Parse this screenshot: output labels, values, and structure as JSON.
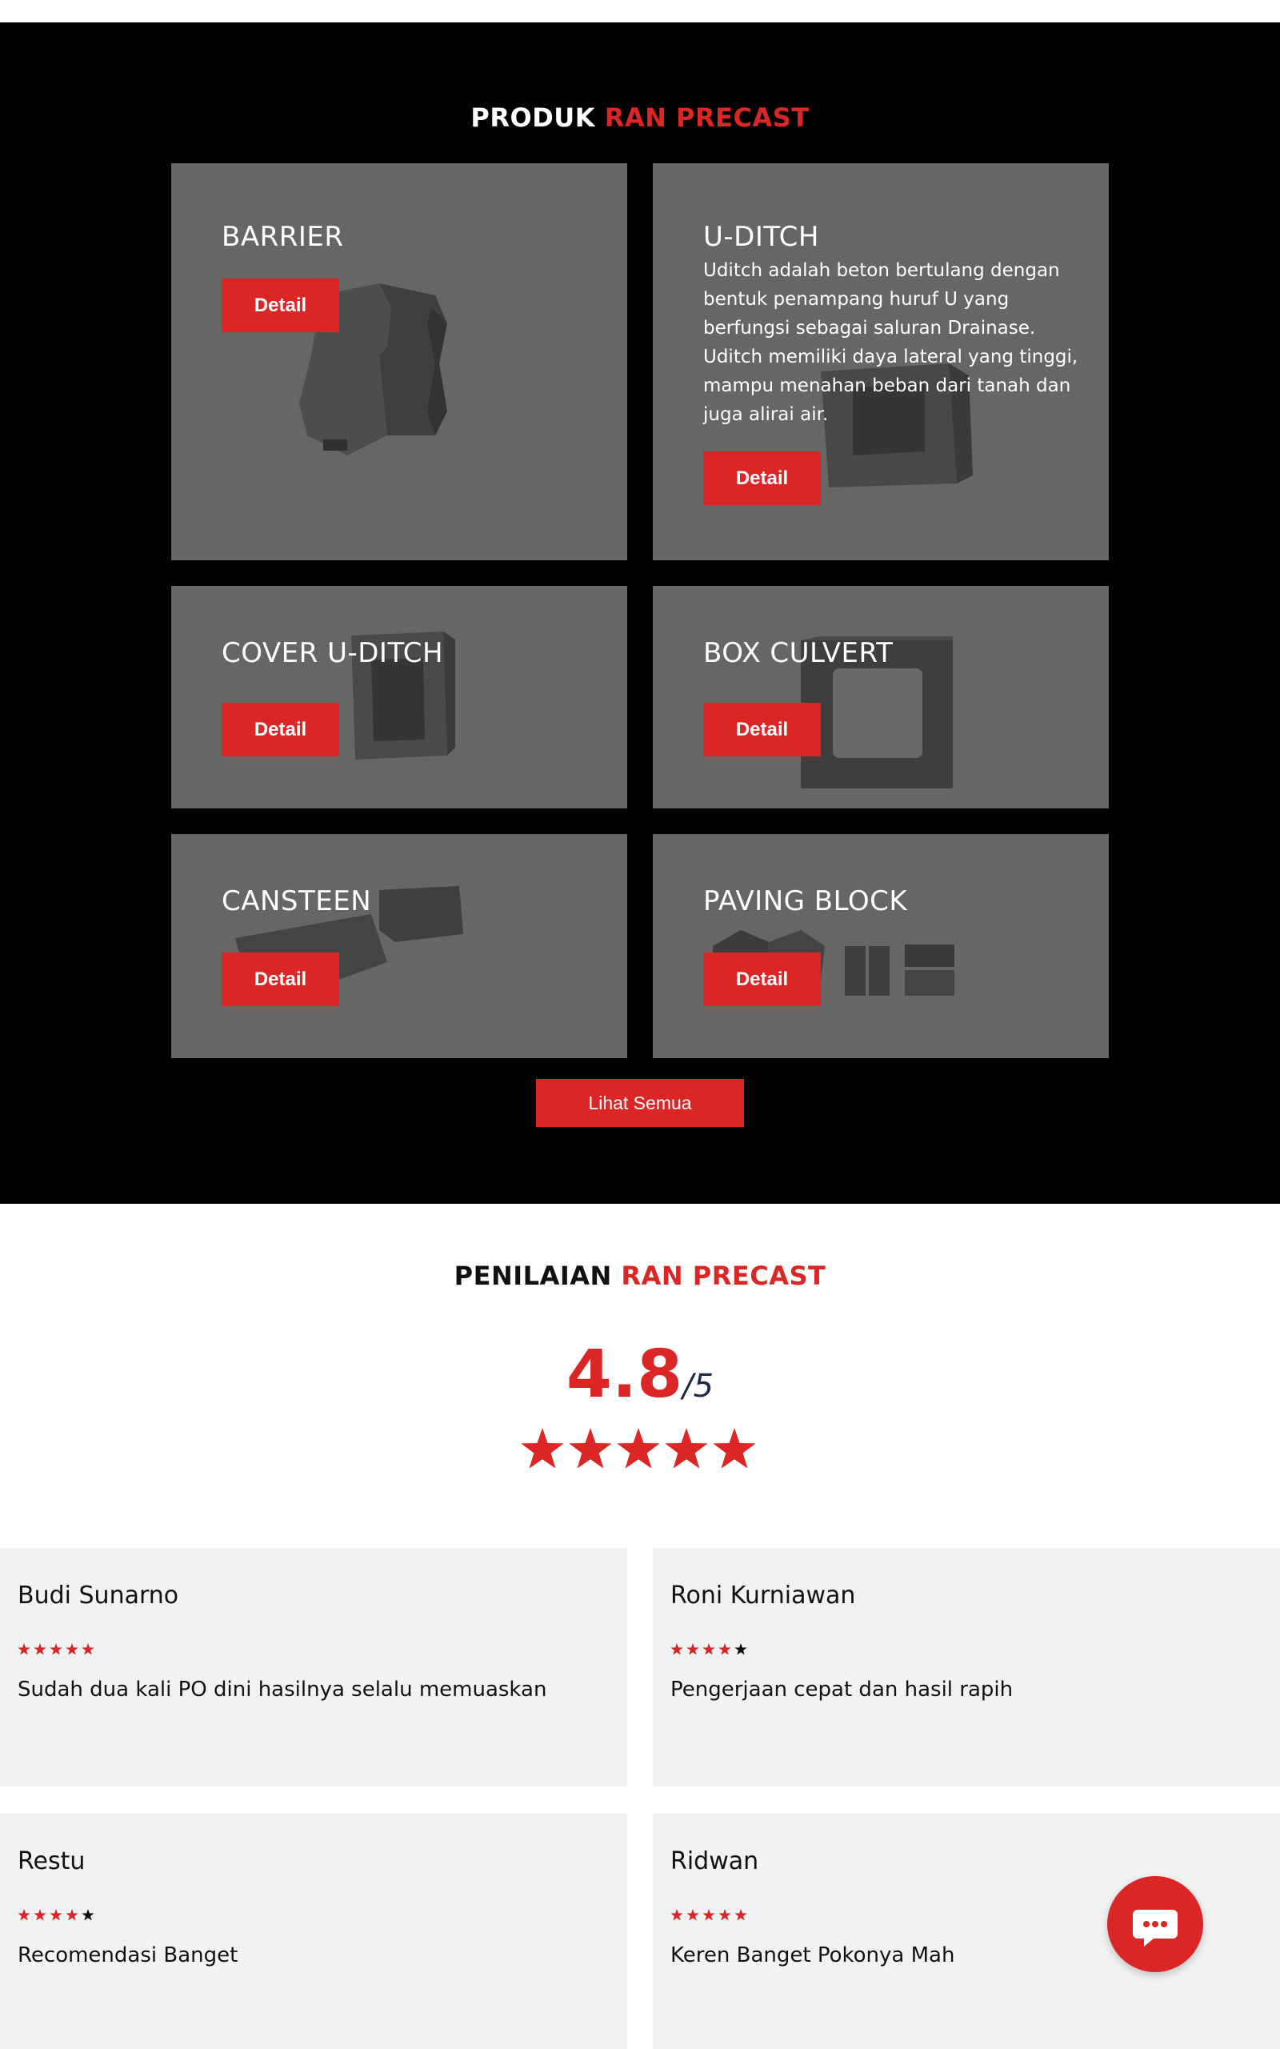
{
  "products": {
    "title_prefix": "PRODUK",
    "title_brand": "RAN PRECAST",
    "items": [
      {
        "title": "BARRIER",
        "button": "Detail"
      },
      {
        "title": "U-DITCH",
        "description": "Uditch adalah beton bertulang dengan bentuk penampang huruf U yang berfungsi sebagai saluran Drainase. Uditch memiliki daya lateral yang tinggi, mampu menahan beban dari tanah dan juga alirai air.",
        "button": "Detail"
      },
      {
        "title": "COVER U-DITCH",
        "button": "Detail"
      },
      {
        "title": "BOX CULVERT",
        "button": "Detail"
      },
      {
        "title": "CANSTEEN",
        "button": "Detail"
      },
      {
        "title": "PAVING BLOCK",
        "button": "Detail"
      }
    ],
    "see_all": "Lihat Semua"
  },
  "ratings": {
    "title_prefix": "PENILAIAN",
    "title_brand": "RAN PRECAST",
    "score": "4.8",
    "score_max": "/5",
    "star_value": 4.8,
    "reviews": [
      {
        "name": "Budi Sunarno",
        "stars": 5,
        "text": "Sudah dua kali PO dini hasilnya selalu memuaskan"
      },
      {
        "name": "Roni Kurniawan",
        "stars": 4,
        "text": "Pengerjaan cepat dan hasil rapih"
      },
      {
        "name": "Restu",
        "stars": 4,
        "text": "Recomendasi Banget"
      },
      {
        "name": "Ridwan",
        "stars": 5,
        "text": "Keren Banget Pokonya Mah"
      }
    ]
  },
  "colors": {
    "accent": "#dc2626",
    "card": "#666666",
    "section_dark": "#000000",
    "review_bg": "#f1f2f4"
  },
  "icons": {
    "chat": "chat-bubble-icon",
    "star": "star-icon"
  }
}
